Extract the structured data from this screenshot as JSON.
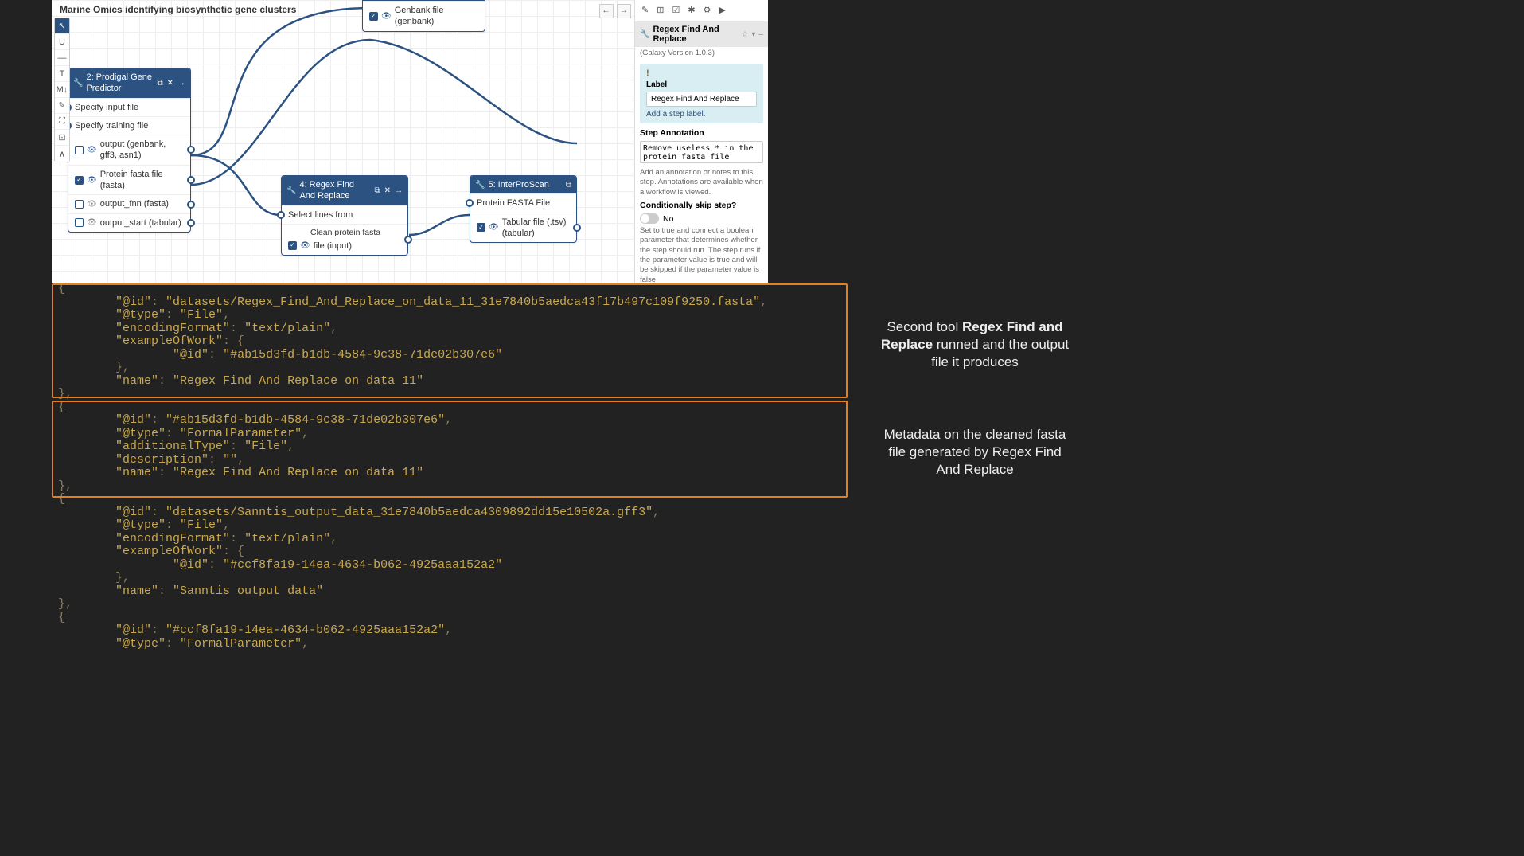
{
  "app": {
    "title": "Marine Omics identifying biosynthetic gene clusters"
  },
  "toolbar": [
    "↖",
    "U",
    "—",
    "T",
    "M↓",
    "✎",
    "⛶",
    "⊡",
    "∧"
  ],
  "nav": {
    "back": "←",
    "fwd": "→"
  },
  "sidebar": {
    "icons": [
      "✎",
      "⊞",
      "☑",
      "✱",
      "⚙",
      "▶"
    ],
    "panel_title": "Regex Find And Replace",
    "version": "(Galaxy Version 1.0.3)",
    "warn_icon": "!",
    "label_label": "Label",
    "label_value": "Regex Find And Replace",
    "add_label": "Add a step label.",
    "step_annot_label": "Step Annotation",
    "step_annot_value": "Remove useless * in the protein fasta file",
    "annot_help": "Add an annotation or notes to this step. Annotations are available when a workflow is viewed.",
    "skip_label": "Conditionally skip step?",
    "skip_value": "No",
    "skip_help": "Set to true and connect a boolean parameter that determines whether the step should run. The step runs if the parameter value is true and will be skipped if the parameter value is false"
  },
  "nodes": {
    "prodigal": {
      "title": "2: Prodigal Gene Predictor",
      "inputs": [
        "Specify input file",
        "Specify training file"
      ],
      "outputs": [
        {
          "label": "output (genbank, gff3, asn1)",
          "checked": false,
          "eye": true
        },
        {
          "label": "Protein fasta file (fasta)",
          "checked": true,
          "eye": true
        },
        {
          "label": "output_fnn (fasta)",
          "checked": false,
          "eye": false
        },
        {
          "label": "output_start (tabular)",
          "checked": false,
          "eye": false
        }
      ]
    },
    "genbank": {
      "label": "Genbank file (genbank)"
    },
    "regex": {
      "title": "4: Regex Find And Replace",
      "input": "Select lines from",
      "out_sublabel": "Clean protein fasta",
      "out_label": "file (input)"
    },
    "interpro": {
      "title": "5: InterProScan",
      "input": "Protein FASTA File",
      "out_label": "Tabular file (.tsv) (tabular)"
    }
  },
  "annotations": {
    "a1_pre": "Second tool ",
    "a1_bold": "Regex Find and Replace",
    "a1_post": " runned and the output file it produces",
    "a2": "Metadata on the cleaned fasta file generated by Regex Find And Replace"
  },
  "code": [
    {
      "i": 0,
      "t": "{"
    },
    {
      "i": 2,
      "k": "\"@id\"",
      "v": "\"datasets/Regex_Find_And_Replace_on_data_11_31e7840b5aedca43f17b497c109f9250.fasta\"",
      "c": true
    },
    {
      "i": 2,
      "k": "\"@type\"",
      "v": "\"File\"",
      "c": true
    },
    {
      "i": 2,
      "k": "\"encodingFormat\"",
      "v": "\"text/plain\"",
      "c": true
    },
    {
      "i": 2,
      "k": "\"exampleOfWork\"",
      "t2": ": {"
    },
    {
      "i": 4,
      "k": "\"@id\"",
      "v": "\"#ab15d3fd-b1db-4584-9c38-71de02b307e6\""
    },
    {
      "i": 2,
      "t": "},"
    },
    {
      "i": 2,
      "k": "\"name\"",
      "v": "\"Regex Find And Replace on data 11\""
    },
    {
      "i": 0,
      "t": "},"
    },
    {
      "i": 0,
      "t": "{"
    },
    {
      "i": 2,
      "k": "\"@id\"",
      "v": "\"#ab15d3fd-b1db-4584-9c38-71de02b307e6\"",
      "c": true
    },
    {
      "i": 2,
      "k": "\"@type\"",
      "v": "\"FormalParameter\"",
      "c": true
    },
    {
      "i": 2,
      "k": "\"additionalType\"",
      "v": "\"File\"",
      "c": true
    },
    {
      "i": 2,
      "k": "\"description\"",
      "v": "\"\"",
      "c": true
    },
    {
      "i": 2,
      "k": "\"name\"",
      "v": "\"Regex Find And Replace on data 11\""
    },
    {
      "i": 0,
      "t": "},"
    },
    {
      "i": 0,
      "t": "{"
    },
    {
      "i": 2,
      "k": "\"@id\"",
      "v": "\"datasets/Sanntis_output_data_31e7840b5aedca4309892dd15e10502a.gff3\"",
      "c": true
    },
    {
      "i": 2,
      "k": "\"@type\"",
      "v": "\"File\"",
      "c": true
    },
    {
      "i": 2,
      "k": "\"encodingFormat\"",
      "v": "\"text/plain\"",
      "c": true
    },
    {
      "i": 2,
      "k": "\"exampleOfWork\"",
      "t2": ": {"
    },
    {
      "i": 4,
      "k": "\"@id\"",
      "v": "\"#ccf8fa19-14ea-4634-b062-4925aaa152a2\""
    },
    {
      "i": 2,
      "t": "},"
    },
    {
      "i": 2,
      "k": "\"name\"",
      "v": "\"Sanntis output data\""
    },
    {
      "i": 0,
      "t": "},"
    },
    {
      "i": 0,
      "t": "{"
    },
    {
      "i": 2,
      "k": "\"@id\"",
      "v": "\"#ccf8fa19-14ea-4634-b062-4925aaa152a2\"",
      "c": true
    },
    {
      "i": 2,
      "k": "\"@type\"",
      "v": "\"FormalParameter\"",
      "c": true
    }
  ]
}
